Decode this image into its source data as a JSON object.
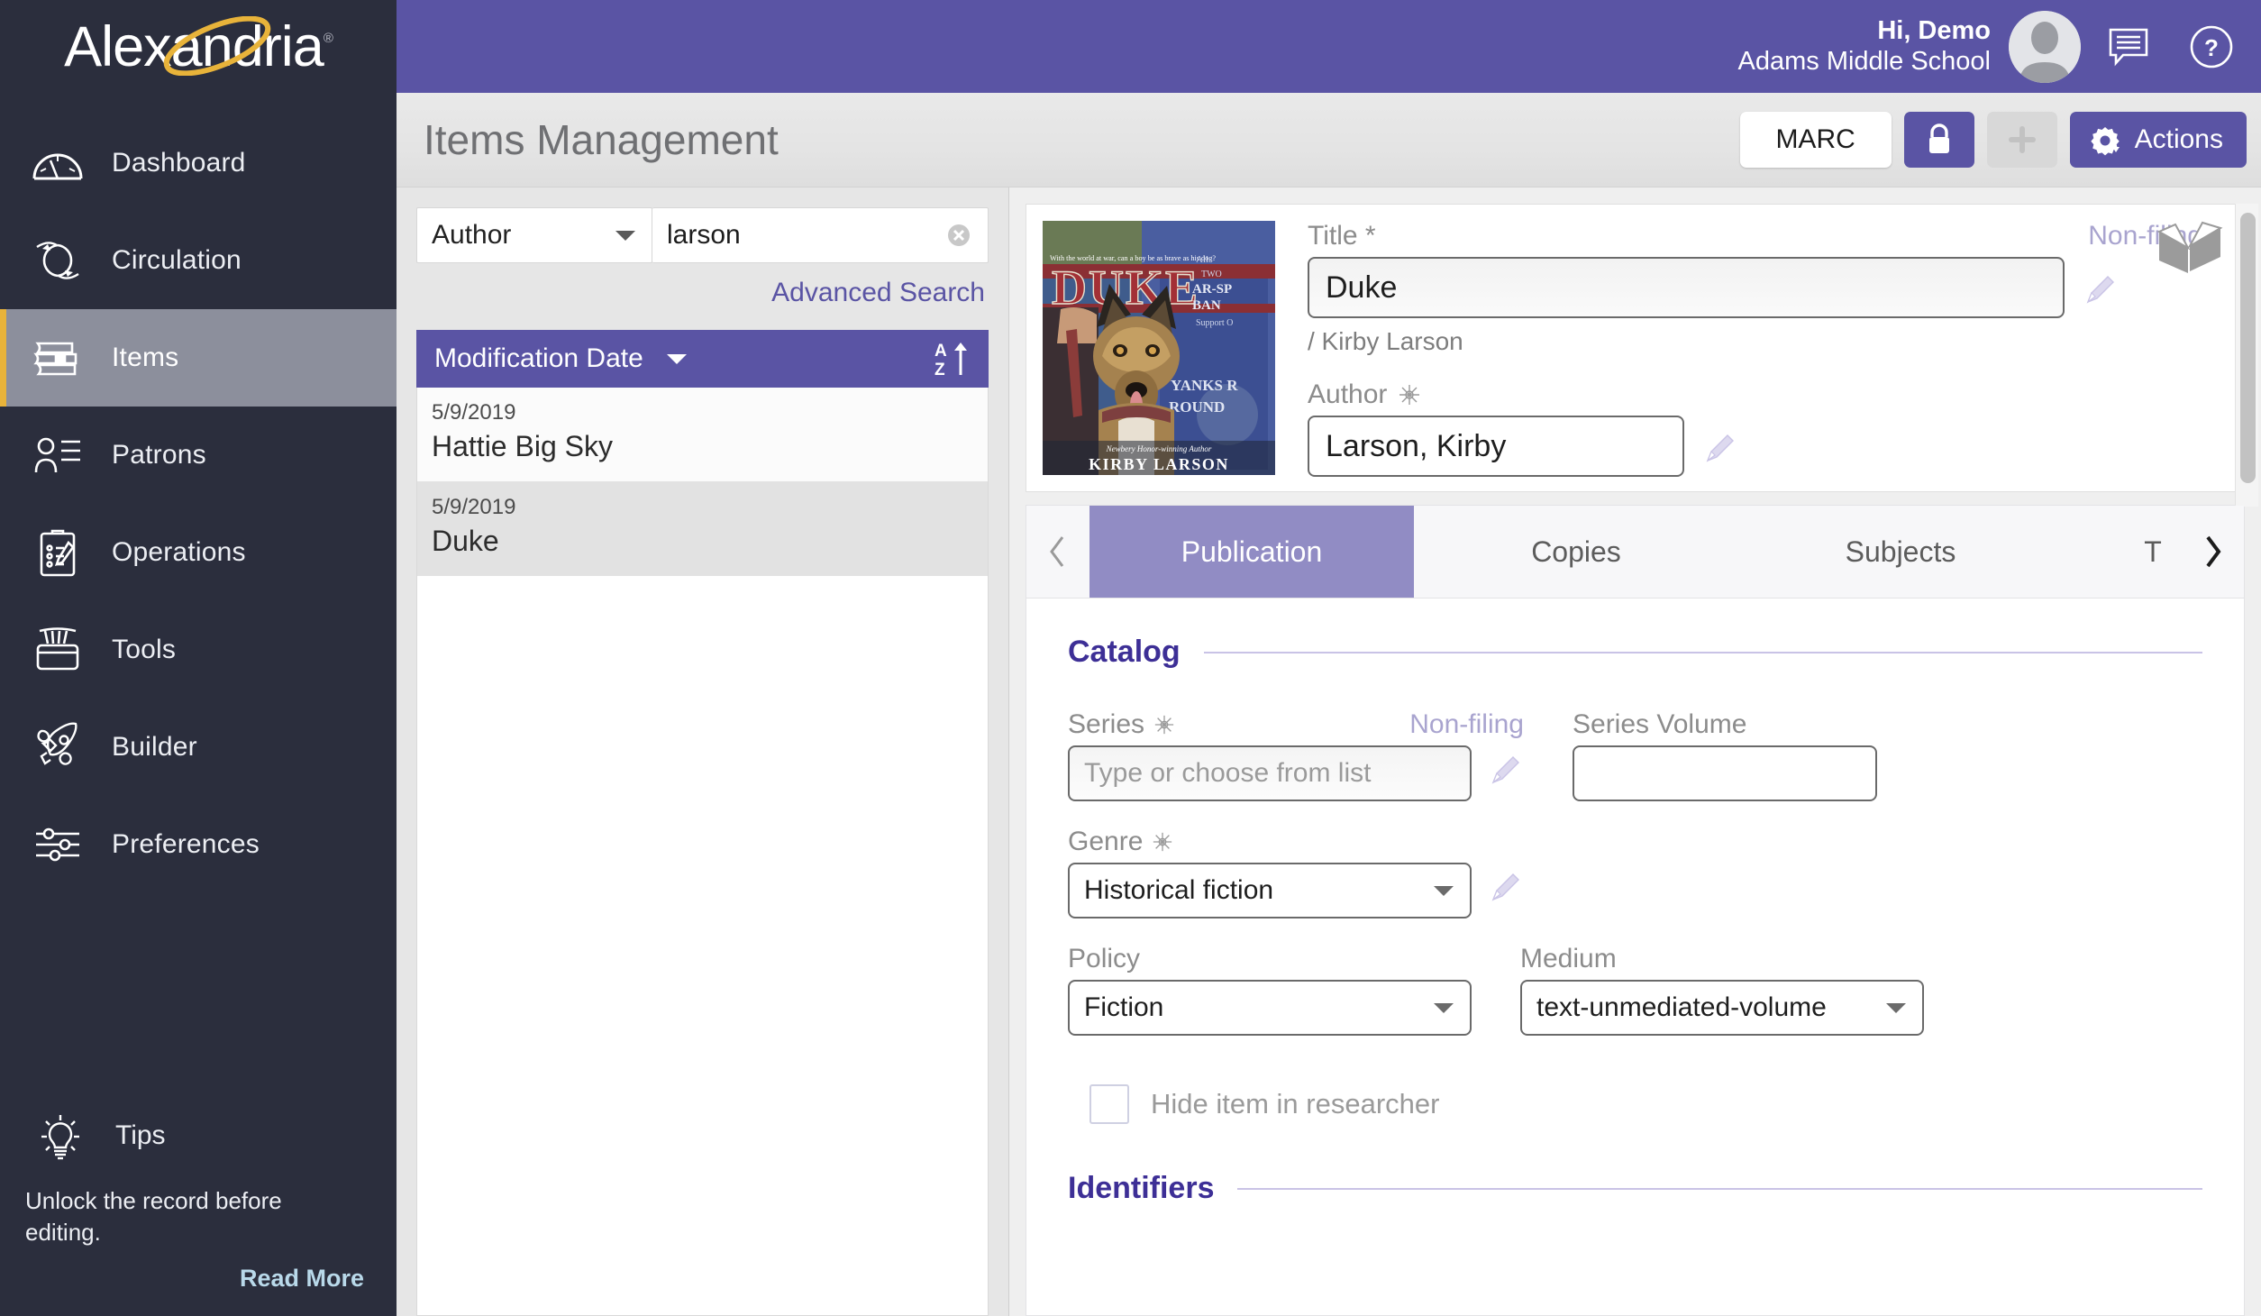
{
  "app": {
    "logo_text": "Alexandria",
    "logo_registered": "®"
  },
  "sidebar": {
    "items": [
      {
        "label": "Dashboard",
        "icon": "gauge-icon",
        "active": false
      },
      {
        "label": "Circulation",
        "icon": "circulation-arrows-icon",
        "active": false
      },
      {
        "label": "Items",
        "icon": "books-stack-icon",
        "active": true
      },
      {
        "label": "Patrons",
        "icon": "person-list-icon",
        "active": false
      },
      {
        "label": "Operations",
        "icon": "clipboard-icon",
        "active": false
      },
      {
        "label": "Tools",
        "icon": "toolbox-icon",
        "active": false
      },
      {
        "label": "Builder",
        "icon": "rocket-wrench-icon",
        "active": false
      },
      {
        "label": "Preferences",
        "icon": "sliders-icon",
        "active": false
      }
    ],
    "tips": {
      "heading": "Tips",
      "icon": "lightbulb-icon",
      "body": "Unlock the record before editing.",
      "link": "Read More"
    },
    "accent_color": "#e8b33a",
    "background_color": "#2b2e3d"
  },
  "topbar": {
    "greeting": "Hi, Demo",
    "organization": "Adams Middle School",
    "avatar_icon": "user-avatar",
    "chat_icon": "chat-bubble-icon",
    "help_icon": "question-mark-icon",
    "background_color": "#5a54a4"
  },
  "page": {
    "title": "Items Management",
    "buttons": {
      "marc": "MARC",
      "lock_icon": "lock-icon",
      "add_icon": "plus-icon",
      "actions": "Actions",
      "actions_icon": "gear-icon"
    }
  },
  "search": {
    "field_type": "Author",
    "query": "larson",
    "clear_icon": "clear-circle-icon",
    "advanced_link": "Advanced Search",
    "sort": {
      "label": "Modification Date",
      "icon": "sort-az-icon"
    },
    "results": [
      {
        "date": "5/9/2019",
        "title": "Hattie Big Sky",
        "selected": false
      },
      {
        "date": "5/9/2019",
        "title": "Duke",
        "selected": true
      }
    ]
  },
  "record": {
    "cover": {
      "tagline": "With the world at war, can a boy be as brave as his dog?",
      "title": "DUKE",
      "author_credit": "Newbery Honor-winning Author",
      "author": "KIRBY LARSON",
      "poster_words": [
        "AR-SP",
        "BAN",
        "YANKS",
        "ROUND"
      ]
    },
    "title_label": "Title",
    "title_required_mark": "*",
    "title_value": "Duke",
    "nonfiling_label": "Non-filing",
    "byline": "/ Kirby Larson",
    "author_label": "Author",
    "author_value": "Larson, Kirby",
    "bookmark_icon": "open-book-icon",
    "pencil_icon": "pencil-edit-icon",
    "authority_icon": "authority-asterisk-icon"
  },
  "tabs": {
    "prev_icon": "chevron-left-icon",
    "next_icon": "chevron-right-icon",
    "items": [
      {
        "label": "Publication",
        "active": true
      },
      {
        "label": "Copies",
        "active": false
      },
      {
        "label": "Subjects",
        "active": false
      },
      {
        "label": "T",
        "active": false
      }
    ]
  },
  "form": {
    "sections": [
      {
        "heading": "Catalog"
      },
      {
        "heading": "Identifiers"
      }
    ],
    "series_label": "Series",
    "series_nonfiling": "Non-filing",
    "series_placeholder": "Type or choose from list",
    "series_value": "",
    "series_volume_label": "Series Volume",
    "series_volume_value": "",
    "genre_label": "Genre",
    "genre_value": "Historical fiction",
    "policy_label": "Policy",
    "policy_value": "Fiction",
    "medium_label": "Medium",
    "medium_value": "text-unmediated-volume",
    "hide_checkbox_label": "Hide item in researcher",
    "hide_checkbox_checked": false
  },
  "colors": {
    "brand_purple": "#5a54a4",
    "tab_active": "#918cc4",
    "section_heading": "#3d2f96",
    "accent_gold": "#e8b33a",
    "sidebar_bg": "#2b2e3d",
    "link_blue": "#b9d9ea"
  }
}
